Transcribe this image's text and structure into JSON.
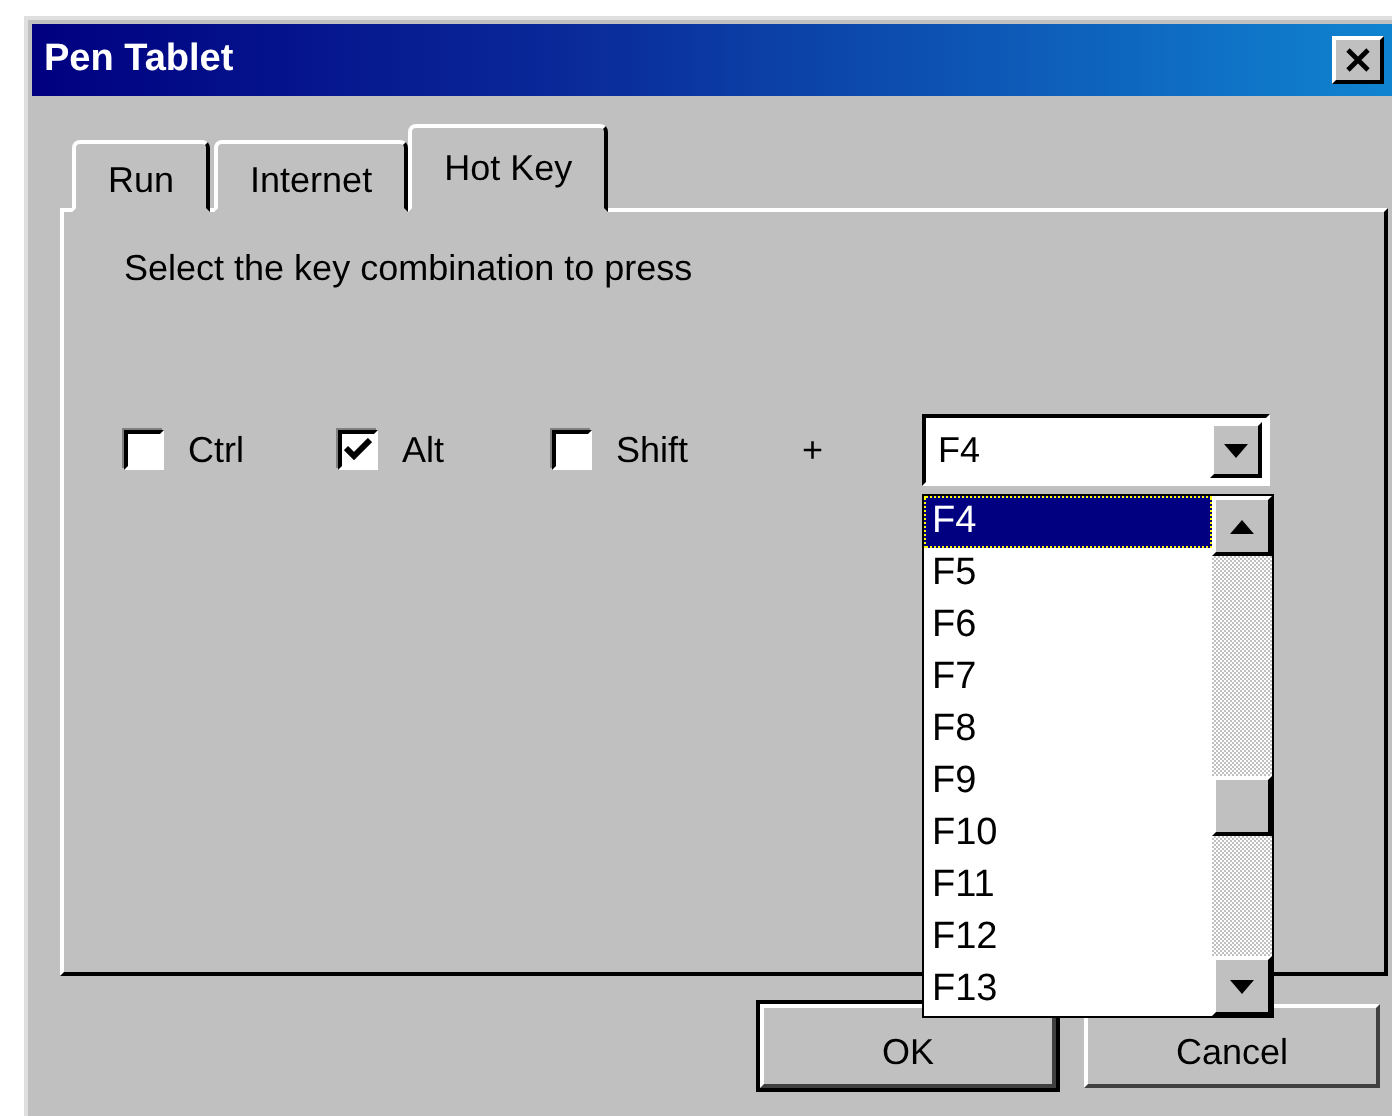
{
  "window": {
    "title": "Pen Tablet"
  },
  "tabs": [
    {
      "label": "Run",
      "selected": false
    },
    {
      "label": "Internet",
      "selected": false
    },
    {
      "label": "Hot Key",
      "selected": true
    }
  ],
  "instruction": "Select the key combination to press",
  "modifiers": [
    {
      "label": "Ctrl",
      "checked": false
    },
    {
      "label": "Alt",
      "checked": true
    },
    {
      "label": "Shift",
      "checked": false
    }
  ],
  "plus": "+",
  "key_combo": {
    "value": "F4",
    "expanded": true,
    "options": [
      {
        "label": "F4",
        "selected": true
      },
      {
        "label": "F5",
        "selected": false
      },
      {
        "label": "F6",
        "selected": false
      },
      {
        "label": "F7",
        "selected": false
      },
      {
        "label": "F8",
        "selected": false
      },
      {
        "label": "F9",
        "selected": false
      },
      {
        "label": "F10",
        "selected": false
      },
      {
        "label": "F11",
        "selected": false
      },
      {
        "label": "F12",
        "selected": false
      },
      {
        "label": "F13",
        "selected": false
      }
    ]
  },
  "buttons": [
    "OK",
    "Cancel"
  ]
}
